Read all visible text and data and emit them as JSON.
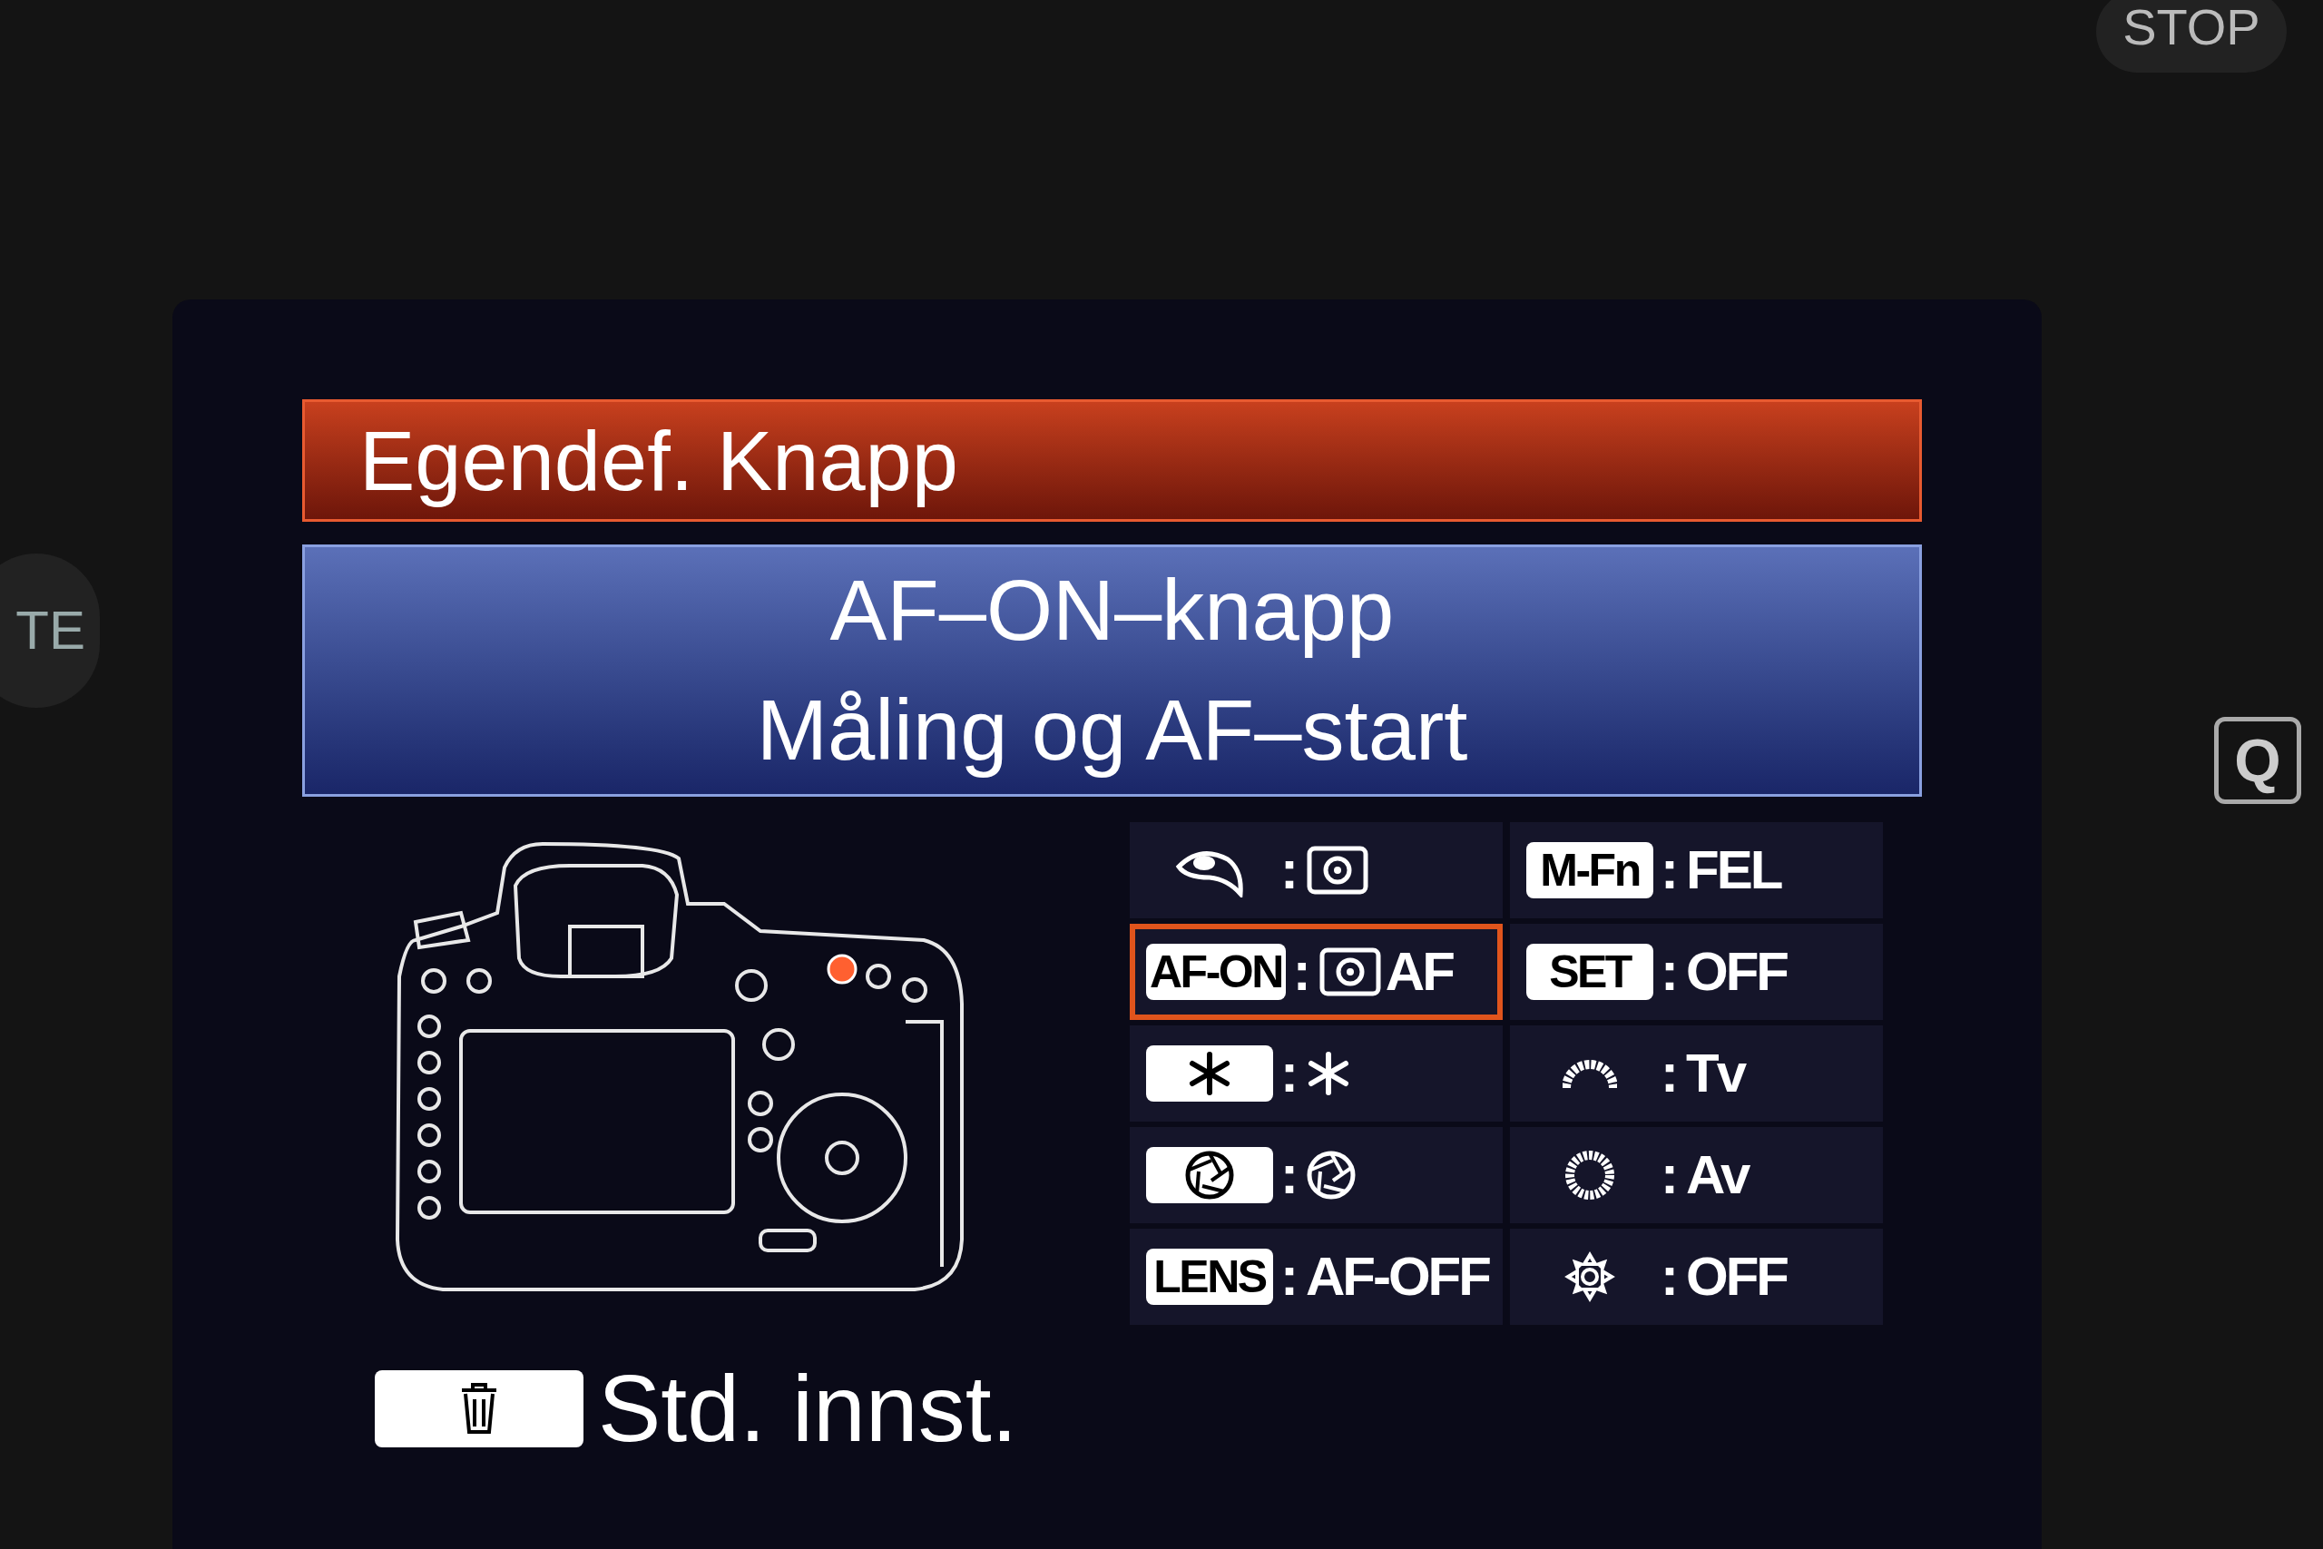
{
  "body_buttons": [
    {
      "label": "STOP"
    },
    {
      "label": "TE"
    },
    {
      "label": "Q"
    }
  ],
  "title": "Egendef. Knapp",
  "header": {
    "button": "AF–ON–knapp",
    "function": "Måling og AF–start"
  },
  "cells": [
    {
      "kind": "plain",
      "sep": ":",
      "selected": false
    },
    {
      "kind": "badge",
      "key": "M-Fn",
      "sep": ":",
      "value": "FEL",
      "selected": false
    },
    {
      "kind": "badge",
      "key": "AF-ON",
      "sep": ":",
      "value": "AF",
      "selected": true
    },
    {
      "kind": "badge",
      "key": "SET",
      "sep": ":",
      "value": "OFF",
      "selected": false
    },
    {
      "kind": "badge",
      "sep": ":",
      "selected": false
    },
    {
      "kind": "plain",
      "sep": ":",
      "value": "Tv",
      "selected": false
    },
    {
      "kind": "badge",
      "sep": ":",
      "selected": false
    },
    {
      "kind": "plain",
      "sep": ":",
      "value": "Av",
      "selected": false
    },
    {
      "kind": "badge",
      "key": "LENS",
      "sep": ":",
      "value": "AF-OFF",
      "selected": false
    },
    {
      "kind": "plain",
      "sep": ":",
      "value": "OFF",
      "selected": false
    }
  ],
  "footer": {
    "label": "Std. innst."
  }
}
